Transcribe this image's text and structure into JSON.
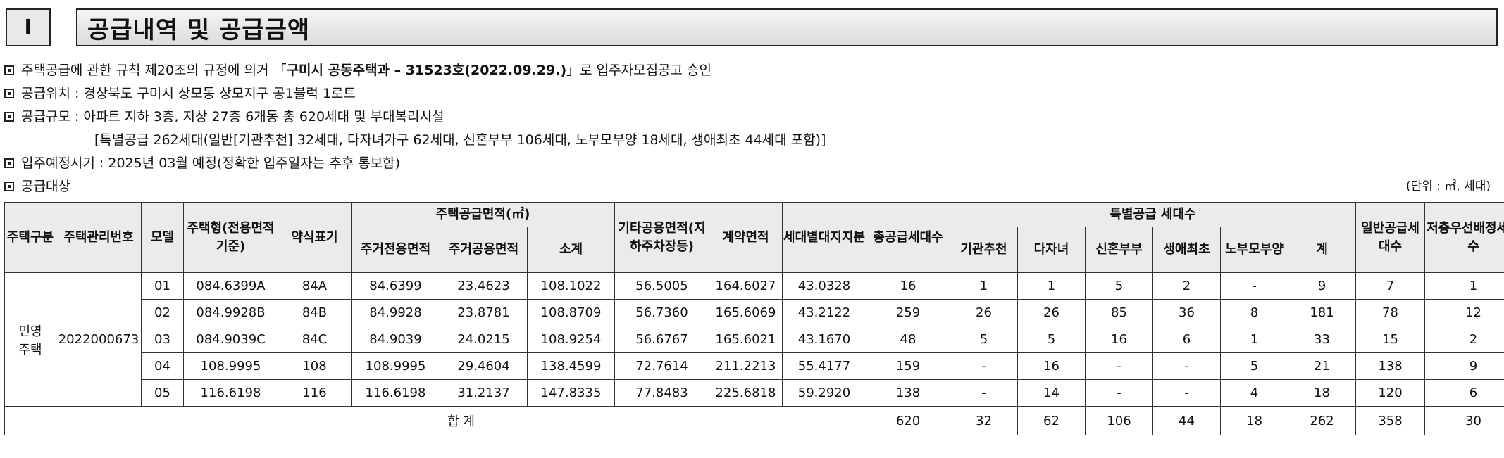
{
  "section": {
    "number": "I",
    "title": "공급내역 및 공급금액"
  },
  "notes": [
    {
      "pre": "주택공급에 관한 규칙 제20조의 규정에 의거 「",
      "bold": "구미시 공동주택과 – 31523호(2022.09.29.)",
      "post": "」로 입주자모집공고 승인"
    },
    {
      "pre": "공급위치 : 경상북도 구미시 상모동 상모지구 공1블럭 1로트",
      "bold": "",
      "post": ""
    },
    {
      "pre": "공급규모 : 아파트 지하 3층, 지상 27층 6개동 총 620세대 및 부대복리시설",
      "bold": "",
      "post": ""
    },
    {
      "pre": "[특별공급 262세대(일반[기관추천] 32세대, 다자녀가구 62세대, 신혼부부 106세대, 노부모부양 18세대, 생애최초 44세대 포함)]",
      "bold": "",
      "post": ""
    },
    {
      "pre": "입주예정시기 : 2025년 03월 예정(정확한 입주일자는 추후 통보함)",
      "bold": "",
      "post": ""
    },
    {
      "pre": "공급대상",
      "bold": "",
      "post": ""
    }
  ],
  "unit_label": "(단위 : ㎡, 세대)",
  "table": {
    "headers": {
      "housing_type": "주택구분",
      "mgmt_no": "주택관리번호",
      "model": "모델",
      "unit_type": "주택형(전용면적기준)",
      "abbr": "약식표기",
      "supply_area": "주택공급면적(㎡)",
      "exclusive": "주거전용면적",
      "common": "주거공용면적",
      "subtotal": "소계",
      "other_common": "기타공용면적(지하주차장등)",
      "contract": "계약면적",
      "land_share": "세대별대지지분",
      "total_units": "총공급세대수",
      "special": "특별공급 세대수",
      "agency": "기관추천",
      "multichild": "다자녀",
      "newlywed": "신혼부부",
      "firsttime": "생애최초",
      "elderly": "노부모부양",
      "special_sum": "계",
      "general": "일반공급세대수",
      "low_floor": "저층우선배정세대수"
    },
    "group": {
      "housing_type_line1": "민영",
      "housing_type_line2": "주택",
      "mgmt_no": "2022000673"
    },
    "rows": [
      {
        "model": "01",
        "type": "084.6399A",
        "abbr": "84A",
        "excl": "84.6399",
        "comm": "23.4623",
        "sub": "108.1022",
        "other": "56.5005",
        "contract": "164.6027",
        "land": "43.0328",
        "total": "16",
        "agency": "1",
        "multi": "1",
        "newly": "5",
        "first": "2",
        "elder": "-",
        "ssum": "9",
        "general": "7",
        "low": "1"
      },
      {
        "model": "02",
        "type": "084.9928B",
        "abbr": "84B",
        "excl": "84.9928",
        "comm": "23.8781",
        "sub": "108.8709",
        "other": "56.7360",
        "contract": "165.6069",
        "land": "43.2122",
        "total": "259",
        "agency": "26",
        "multi": "26",
        "newly": "85",
        "first": "36",
        "elder": "8",
        "ssum": "181",
        "general": "78",
        "low": "12"
      },
      {
        "model": "03",
        "type": "084.9039C",
        "abbr": "84C",
        "excl": "84.9039",
        "comm": "24.0215",
        "sub": "108.9254",
        "other": "56.6767",
        "contract": "165.6021",
        "land": "43.1670",
        "total": "48",
        "agency": "5",
        "multi": "5",
        "newly": "16",
        "first": "6",
        "elder": "1",
        "ssum": "33",
        "general": "15",
        "low": "2"
      },
      {
        "model": "04",
        "type": "108.9995",
        "abbr": "108",
        "excl": "108.9995",
        "comm": "29.4604",
        "sub": "138.4599",
        "other": "72.7614",
        "contract": "211.2213",
        "land": "55.4177",
        "total": "159",
        "agency": "-",
        "multi": "16",
        "newly": "-",
        "first": "-",
        "elder": "5",
        "ssum": "21",
        "general": "138",
        "low": "9"
      },
      {
        "model": "05",
        "type": "116.6198",
        "abbr": "116",
        "excl": "116.6198",
        "comm": "31.2137",
        "sub": "147.8335",
        "other": "77.8483",
        "contract": "225.6818",
        "land": "59.2920",
        "total": "138",
        "agency": "-",
        "multi": "14",
        "newly": "-",
        "first": "-",
        "elder": "4",
        "ssum": "18",
        "general": "120",
        "low": "6"
      }
    ],
    "total_row": {
      "label": "합 계",
      "total": "620",
      "agency": "32",
      "multi": "62",
      "newly": "106",
      "first": "44",
      "elder": "18",
      "ssum": "262",
      "general": "358",
      "low": "30"
    }
  }
}
